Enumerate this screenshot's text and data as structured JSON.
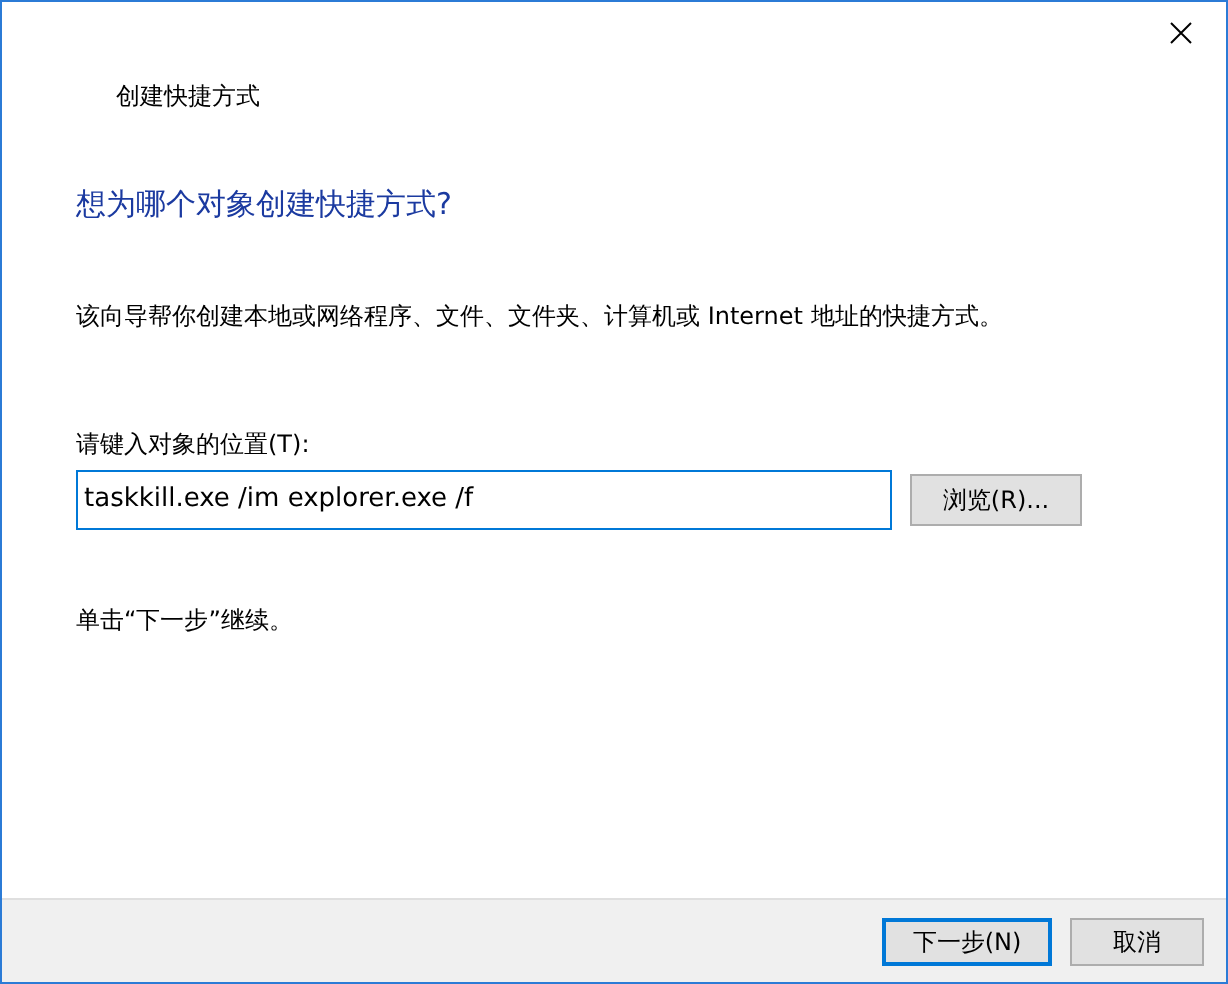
{
  "window": {
    "title": "创建快捷方式"
  },
  "heading": "想为哪个对象创建快捷方式?",
  "description": "该向导帮你创建本地或网络程序、文件、文件夹、计算机或 Internet 地址的快捷方式。",
  "location": {
    "label": "请键入对象的位置(T):",
    "value": "taskkill.exe /im explorer.exe /f",
    "focused": true,
    "browse": "浏览(R)..."
  },
  "hint": "单击“下一步”继续。",
  "buttons": [
    {
      "label": "下一步(N)",
      "default": true
    },
    {
      "label": "取消",
      "default": false
    }
  ]
}
